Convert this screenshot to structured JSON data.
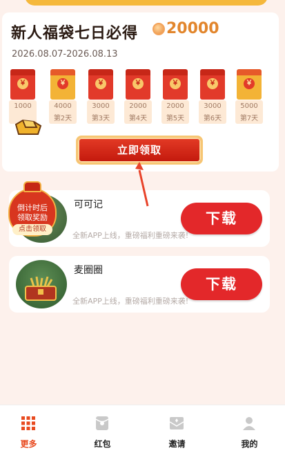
{
  "promo": {
    "title": "新人福袋七日必得",
    "coin_amount": "20000",
    "dates": "2026.08.07-2026.08.13",
    "days": [
      {
        "amount": "1000",
        "label": "",
        "type": "envelope"
      },
      {
        "amount": "4000",
        "label": "第2天",
        "type": "box"
      },
      {
        "amount": "3000",
        "label": "第3天",
        "type": "envelope"
      },
      {
        "amount": "2000",
        "label": "第4天",
        "type": "envelope"
      },
      {
        "amount": "2000",
        "label": "第5天",
        "type": "envelope"
      },
      {
        "amount": "3000",
        "label": "第6天",
        "type": "envelope"
      },
      {
        "amount": "5000",
        "label": "第7天",
        "type": "box"
      }
    ],
    "envelope_symbol": "￥",
    "claim_label": "立即领取"
  },
  "countdown_badge": {
    "line1": "倒计时后",
    "line2": "领取奖励",
    "tag": "点击领取"
  },
  "apps": [
    {
      "name": "可可记",
      "description": "全新APP上线，重磅福利重磅来袭!",
      "download_label": "下载",
      "icon": "app-icon-kekeji"
    },
    {
      "name": "麦圈圈",
      "description": "全新APP上线，重磅福利重磅来袭!",
      "download_label": "下载",
      "icon": "treasure-chest-icon"
    }
  ],
  "nav": {
    "items": [
      {
        "label": "更多",
        "icon": "grid-icon",
        "active": true
      },
      {
        "label": "红包",
        "icon": "red-envelope-icon",
        "active": false
      },
      {
        "label": "邀请",
        "icon": "invite-mail-icon",
        "active": false
      },
      {
        "label": "我的",
        "icon": "user-icon",
        "active": false
      }
    ]
  },
  "colors": {
    "accent": "#e3282a",
    "coin": "#e2862d",
    "active_nav": "#e84a1f",
    "background": "#fdf1ec"
  }
}
